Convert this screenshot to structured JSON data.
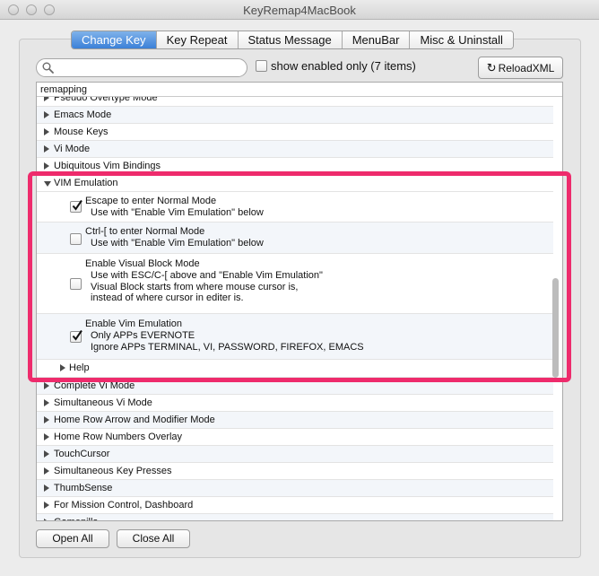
{
  "window": {
    "title": "KeyRemap4MacBook"
  },
  "tabs": [
    {
      "label": "Change Key",
      "active": true
    },
    {
      "label": "Key Repeat",
      "active": false
    },
    {
      "label": "Status Message",
      "active": false
    },
    {
      "label": "MenuBar",
      "active": false
    },
    {
      "label": "Misc & Uninstall",
      "active": false
    }
  ],
  "toolbar": {
    "search_value": "",
    "search_placeholder": "",
    "show_enabled_label": "show enabled only (7 items)",
    "show_enabled_checked": false,
    "reload_label": "ReloadXML"
  },
  "list": {
    "header": "remapping",
    "rows_before": [
      "Pseudo Overtype Mode",
      "Emacs Mode",
      "Mouse Keys",
      "Vi Mode",
      "Ubiquitous Vim Bindings"
    ],
    "expanded_group": "VIM Emulation",
    "options": [
      {
        "title": "Escape to enter Normal Mode",
        "subs": [
          "Use with \"Enable Vim Emulation\" below"
        ],
        "checked": true
      },
      {
        "title": "Ctrl-[ to enter Normal Mode",
        "subs": [
          "Use with \"Enable Vim Emulation\" below"
        ],
        "checked": false
      },
      {
        "title": "Enable Visual Block Mode",
        "subs": [
          "Use with ESC/C-[ above and \"Enable Vim Emulation\"",
          "Visual Block starts from where mouse cursor is,",
          "instead of where cursor in editer is."
        ],
        "checked": false
      },
      {
        "title": "Enable Vim Emulation",
        "subs": [
          "Only APPs EVERNOTE",
          "Ignore APPs TERMINAL, VI, PASSWORD, FIREFOX, EMACS"
        ],
        "checked": true
      }
    ],
    "help": "Help",
    "rows_after": [
      "Complete Vi Mode",
      "Simultaneous Vi Mode",
      "Home Row Arrow and Modifier Mode",
      "Home Row Numbers Overlay",
      "TouchCursor",
      "Simultaneous Key Presses",
      "ThumbSense",
      "For Mission Control, Dashboard",
      "Gamepilla"
    ]
  },
  "buttons": {
    "open_all": "Open All",
    "close_all": "Close All"
  },
  "colors": {
    "highlight": "#ee2b6c",
    "tab_active": "#3b80d8"
  }
}
